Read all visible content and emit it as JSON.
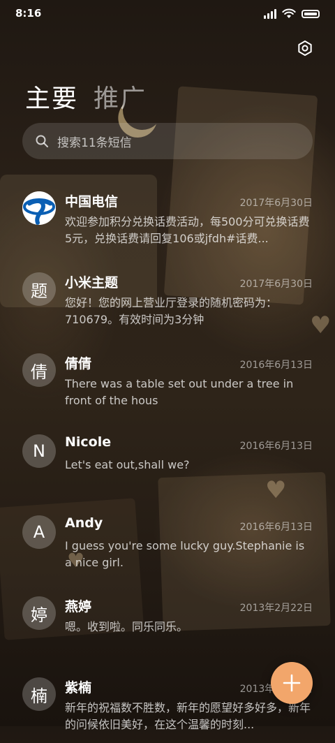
{
  "status_bar": {
    "time": "8:16"
  },
  "tabs": [
    {
      "label": "主要",
      "active": true
    },
    {
      "label": "推广",
      "active": false
    }
  ],
  "search": {
    "placeholder": "搜索11条短信"
  },
  "messages": [
    {
      "sender": "中国电信",
      "date": "2017年6月30日",
      "avatar": "telecom-logo",
      "preview": "欢迎参加积分兑换话费活动，每500分可兑换话费5元，兑换话费请回复106或jfdh#话费..."
    },
    {
      "sender": "小米主题",
      "date": "2017年6月30日",
      "avatar": "题",
      "preview": "您好！您的网上营业厅登录的随机密码为：710679。有效时间为3分钟"
    },
    {
      "sender": "倩倩",
      "date": "2016年6月13日",
      "avatar": "倩",
      "preview": "There was a table set out under a tree in front of the hous"
    },
    {
      "sender": "Nicole",
      "date": "2016年6月13日",
      "avatar": "N",
      "preview": "Let's eat out,shall we?"
    },
    {
      "sender": "Andy",
      "date": "2016年6月13日",
      "avatar": "A",
      "preview": "I guess you're some lucky guy.Stephanie is a nice girl."
    },
    {
      "sender": "燕婷",
      "date": "2013年2月22日",
      "avatar": "婷",
      "preview": "嗯。收到啦。同乐同乐。"
    },
    {
      "sender": "紫楠",
      "date": "2013年2月22日",
      "avatar": "楠",
      "preview": "新年的祝福数不胜数，新年的愿望好多好多，新年的问候依旧美好，在这个温馨的时刻..."
    }
  ],
  "colors": {
    "fab": "#f2a66b",
    "telecom_blue": "#0a5fb4"
  }
}
